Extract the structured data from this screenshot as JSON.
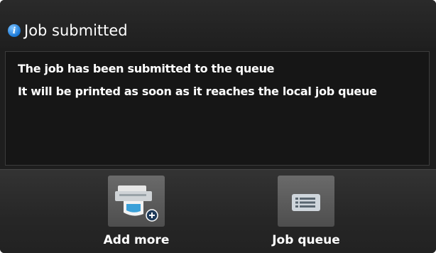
{
  "dialog": {
    "title": "Job submitted",
    "icon": "info-icon",
    "accent_color": "#1a78d6"
  },
  "message": {
    "lines": [
      "The job has been submitted to the queue",
      "It will be printed as soon as it reaches the local job queue"
    ]
  },
  "actions": {
    "add_more": {
      "label": "Add more",
      "icon": "add-print-job-icon"
    },
    "job_queue": {
      "label": "Job queue",
      "icon": "job-queue-list-icon"
    }
  }
}
